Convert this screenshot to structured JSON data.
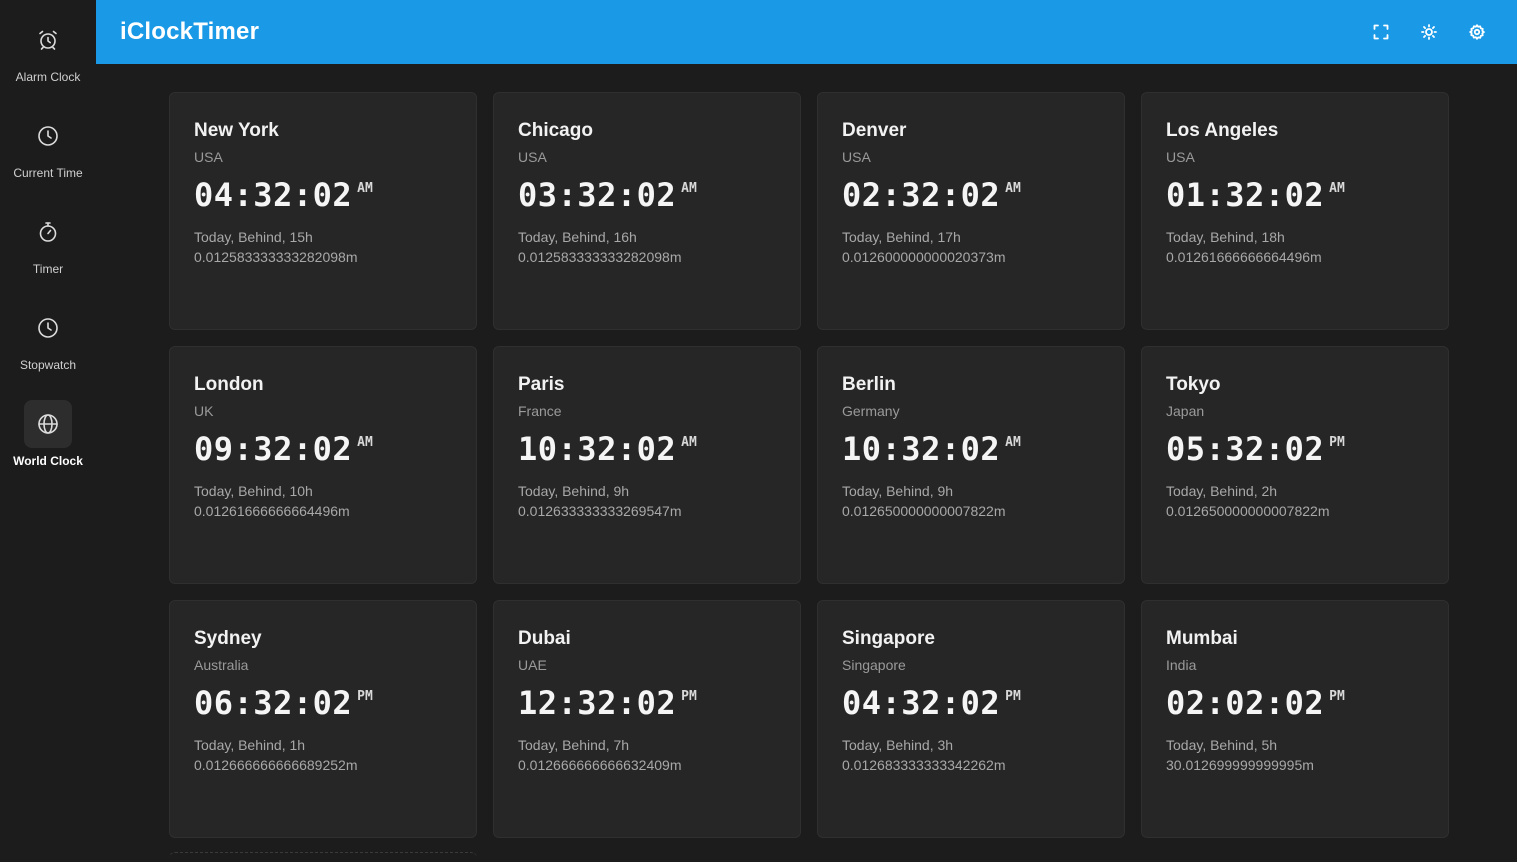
{
  "app": {
    "title": "iClockTimer"
  },
  "sidebar": {
    "items": [
      {
        "label": "Alarm Clock",
        "icon": "alarm-clock-icon",
        "active": false
      },
      {
        "label": "Current Time",
        "icon": "clock-icon",
        "active": false
      },
      {
        "label": "Timer",
        "icon": "timer-icon",
        "active": false
      },
      {
        "label": "Stopwatch",
        "icon": "stopwatch-icon",
        "active": false
      },
      {
        "label": "World Clock",
        "icon": "globe-icon",
        "active": true
      }
    ]
  },
  "header": {
    "actions": [
      {
        "icon": "fullscreen-icon"
      },
      {
        "icon": "brightness-icon"
      },
      {
        "icon": "gear-icon"
      }
    ]
  },
  "colors": {
    "header": "#1a9ae6",
    "background": "#1c1c1c",
    "card": "#262626"
  },
  "clocks": [
    {
      "city": "New York",
      "country": "USA",
      "time": "04:32:02",
      "ampm": "AM",
      "offset": "Today, Behind, 15h",
      "diff": "0.012583333333282098m"
    },
    {
      "city": "Chicago",
      "country": "USA",
      "time": "03:32:02",
      "ampm": "AM",
      "offset": "Today, Behind, 16h",
      "diff": "0.012583333333282098m"
    },
    {
      "city": "Denver",
      "country": "USA",
      "time": "02:32:02",
      "ampm": "AM",
      "offset": "Today, Behind, 17h",
      "diff": "0.012600000000020373m"
    },
    {
      "city": "Los Angeles",
      "country": "USA",
      "time": "01:32:02",
      "ampm": "AM",
      "offset": "Today, Behind, 18h",
      "diff": "0.01261666666664496m"
    },
    {
      "city": "London",
      "country": "UK",
      "time": "09:32:02",
      "ampm": "AM",
      "offset": "Today, Behind, 10h",
      "diff": "0.01261666666664496m"
    },
    {
      "city": "Paris",
      "country": "France",
      "time": "10:32:02",
      "ampm": "AM",
      "offset": "Today, Behind, 9h",
      "diff": "0.012633333333269547m"
    },
    {
      "city": "Berlin",
      "country": "Germany",
      "time": "10:32:02",
      "ampm": "AM",
      "offset": "Today, Behind, 9h",
      "diff": "0.012650000000007822m"
    },
    {
      "city": "Tokyo",
      "country": "Japan",
      "time": "05:32:02",
      "ampm": "PM",
      "offset": "Today, Behind, 2h",
      "diff": "0.012650000000007822m"
    },
    {
      "city": "Sydney",
      "country": "Australia",
      "time": "06:32:02",
      "ampm": "PM",
      "offset": "Today, Behind, 1h",
      "diff": "0.012666666666689252m"
    },
    {
      "city": "Dubai",
      "country": "UAE",
      "time": "12:32:02",
      "ampm": "PM",
      "offset": "Today, Behind, 7h",
      "diff": "0.012666666666632409m"
    },
    {
      "city": "Singapore",
      "country": "Singapore",
      "time": "04:32:02",
      "ampm": "PM",
      "offset": "Today, Behind, 3h",
      "diff": "0.012683333333342262m"
    },
    {
      "city": "Mumbai",
      "country": "India",
      "time": "02:02:02",
      "ampm": "PM",
      "offset": "Today, Behind, 5h 30.012699999999995m",
      "diff": ""
    }
  ]
}
